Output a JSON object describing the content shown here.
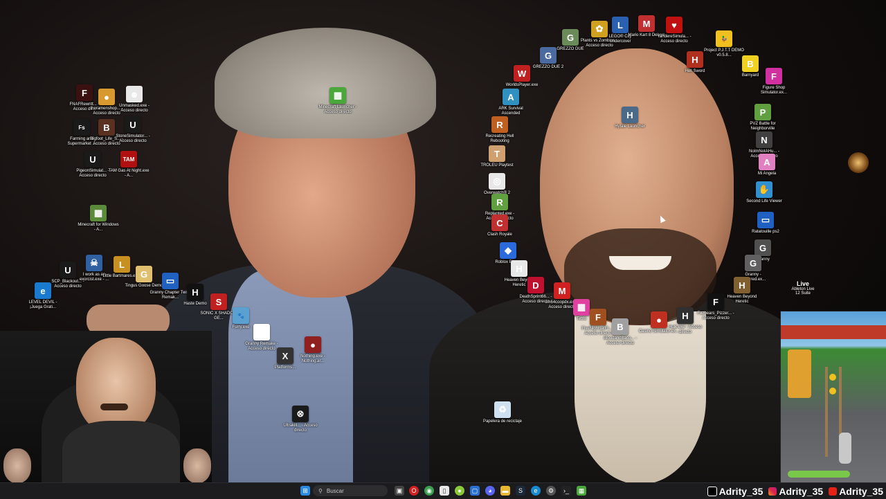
{
  "taskbar": {
    "search_placeholder": "Buscar",
    "socials": [
      {
        "icon": "tiktok-icon",
        "handle": "Adrity_35"
      },
      {
        "icon": "instagram-icon",
        "handle": "Adrity_35"
      },
      {
        "icon": "youtube-icon",
        "handle": "Adrity_35"
      }
    ],
    "apps": [
      "windows-start-icon",
      "task-view-icon",
      "opera-icon",
      "chrome-icon",
      "file-icon",
      "app-green-icon",
      "app-blue-icon",
      "discord-icon",
      "folder-icon",
      "steam-icon",
      "edge-icon",
      "settings-icon",
      "terminal-icon",
      "minecraft-icon"
    ]
  },
  "overlay": {
    "live_label": "Live",
    "ableton_label": "Ableton Live 12 Suite"
  },
  "desktop_icons": [
    {
      "name": "fnaf-rewritten-icon",
      "label": "FNAFRewritt... - Acceso dir...",
      "color": "#3a1010",
      "glyph": "F"
    },
    {
      "name": "theramenshop-icon",
      "label": "theramenshop... - Acceso directo",
      "color": "#d89a30",
      "glyph": "●"
    },
    {
      "name": "unmasked-icon",
      "label": "Unmasked.exe - Acceso directo",
      "color": "#e8e8e8",
      "glyph": "☻"
    },
    {
      "name": "farming-supermarket-icon",
      "label": "Farming and Supermarket ...",
      "color": "#1a1a1a",
      "glyph": "Fs"
    },
    {
      "name": "bigfoot-icon",
      "label": "Bigfoot_Life_S... - Acceso directo",
      "color": "#5a3020",
      "glyph": "B"
    },
    {
      "name": "stone-simulator-icon",
      "label": "StoneSimulator... - Acceso directo",
      "color": "#1a1a1a",
      "glyph": "U"
    },
    {
      "name": "pigeon-simulator-icon",
      "label": "PigeonSimulat... - Acceso directo",
      "color": "#1a1a1a",
      "glyph": "U"
    },
    {
      "name": "tam-gas-icon",
      "label": "TAM Gas At Night.exe - A...",
      "color": "#b01010",
      "glyph": "TAM"
    },
    {
      "name": "minecraft-windows-icon",
      "label": "Minecraft for Windows - A...",
      "color": "#5b8a3a",
      "glyph": "▦"
    },
    {
      "name": "minecraft-launcher-icon",
      "label": "Minecraft Launcher - Acceso directo",
      "color": "#4aa83a",
      "glyph": "▦"
    },
    {
      "name": "scp-blackout-icon",
      "label": "SCP_Blackout... - Acceso directo",
      "color": "#1a1a1a",
      "glyph": "U"
    },
    {
      "name": "exorcist-icon",
      "label": "I work as an exorcist.exe - ...",
      "color": "#3060a0",
      "glyph": "☠"
    },
    {
      "name": "little-bartmares-icon",
      "label": "Little Bartmares.ex...",
      "color": "#c89020",
      "glyph": "L"
    },
    {
      "name": "tingus-goose-icon",
      "label": "Tingus Goose Demo",
      "color": "#e0c070",
      "glyph": "G"
    },
    {
      "name": "granny-chapter-two-icon",
      "label": "Granny Chapter Two - Remak...",
      "color": "#2060c0",
      "glyph": "▭"
    },
    {
      "name": "level-devil-icon",
      "label": "LEVEL DEVIL - ¡Juega Grati...",
      "color": "#1a7ad0",
      "glyph": "e"
    },
    {
      "name": "haste-demo-icon",
      "label": "Haste Demo",
      "color": "#111111",
      "glyph": "H"
    },
    {
      "name": "sonic-shadow-icon",
      "label": "SONIC X SHADOW GE...",
      "color": "#c02020",
      "glyph": "S"
    },
    {
      "name": "furry-icon",
      "label": "Furry.exe",
      "color": "#5aa0d0",
      "glyph": "🐾"
    },
    {
      "name": "granny-remake-icon",
      "label": "Granny Remake - Acceso directo",
      "color": "#ffffff",
      "glyph": "▭"
    },
    {
      "name": "nothing-icon",
      "label": "Nothing.exe - Nothing.ar...",
      "color": "#902020",
      "glyph": "●"
    },
    {
      "name": "platforms-icon",
      "label": "Platforms...",
      "color": "#333333",
      "glyph": "X"
    },
    {
      "name": "ultrakill-icon",
      "label": "Ultrakill... - Acceso directo",
      "color": "#1a1a1a",
      "glyph": "⊗"
    },
    {
      "name": "recycle-bin-icon",
      "label": "Papelera de reciclaje",
      "color": "#cfe0f0",
      "glyph": "♻"
    },
    {
      "name": "grezzo-due-icon",
      "label": "GREZZO DUE",
      "color": "#6a8a5a",
      "glyph": "G"
    },
    {
      "name": "grezzo-due-2-icon",
      "label": "GREZZO DUE 2",
      "color": "#4a6aa0",
      "glyph": "G"
    },
    {
      "name": "plants-zombies-icon",
      "label": "Plants vs Zombies... Acceso directo",
      "color": "#d0a020",
      "glyph": "✿"
    },
    {
      "name": "lego-city-icon",
      "label": "LEGO® City Undercover",
      "color": "#2a60b0",
      "glyph": "L"
    },
    {
      "name": "mario-kart-icon",
      "label": "Mario Kart 8 Deluxe",
      "color": "#c03030",
      "glyph": "M"
    },
    {
      "name": "yandere-simulator-icon",
      "label": "YandereSimula... - Acceso directo",
      "color": "#c01010",
      "glyph": "♥"
    },
    {
      "name": "pjtt-demo-icon",
      "label": "Project P.J.T.T DEMO v0.5.8...",
      "color": "#f0c020",
      "glyph": "🦆"
    },
    {
      "name": "worldsplayer-icon",
      "label": "WorldsPlayer.exe",
      "color": "#c02020",
      "glyph": "W"
    },
    {
      "name": "hell-sword-icon",
      "label": "Hell Sword",
      "color": "#b03020",
      "glyph": "H"
    },
    {
      "name": "barnyard-icon",
      "label": "Barnyard",
      "color": "#f0d020",
      "glyph": "B"
    },
    {
      "name": "ark-survival-icon",
      "label": "ARK Survival Ascended",
      "color": "#3090c0",
      "glyph": "A"
    },
    {
      "name": "figure-shop-icon",
      "label": "Figure Shop Simulator.ex...",
      "color": "#d030a0",
      "glyph": "F"
    },
    {
      "name": "hytale-launcher-icon",
      "label": "Hytale Launcher",
      "color": "#4a6a8a",
      "glyph": "H"
    },
    {
      "name": "recreating-hell-icon",
      "label": "Recreating Hell Rebooting",
      "color": "#c06020",
      "glyph": "R"
    },
    {
      "name": "pvz-neighborville-icon",
      "label": "PVZ Battle for Neighborville",
      "color": "#60a040",
      "glyph": "P"
    },
    {
      "name": "troleu-playtest-icon",
      "label": "TROLEU Playtest",
      "color": "#d0a070",
      "glyph": "T"
    },
    {
      "name": "noimnot-icon",
      "label": "NoImNotAHu... - Acceso directo",
      "color": "#404040",
      "glyph": "N"
    },
    {
      "name": "overwatch-icon",
      "label": "Overwatch® 2",
      "color": "#e8e8e8",
      "glyph": "◎"
    },
    {
      "name": "mi-angela-icon",
      "label": "Mi Angela",
      "color": "#e080c0",
      "glyph": "A"
    },
    {
      "name": "replanted-icon",
      "label": "Replanted.exe - Acceso directo",
      "color": "#60a040",
      "glyph": "R"
    },
    {
      "name": "second-life-icon",
      "label": "Second Life Viewer",
      "color": "#3090d0",
      "glyph": "✋"
    },
    {
      "name": "clash-royale-icon",
      "label": "Clash Royale",
      "color": "#c03030",
      "glyph": "C"
    },
    {
      "name": "ratatouille-icon",
      "label": "Ratatouille ps2",
      "color": "#2060c0",
      "glyph": "▭"
    },
    {
      "name": "roblox-player-icon",
      "label": "Roblox Player",
      "color": "#2a6adc",
      "glyph": "◆"
    },
    {
      "name": "granny-icon",
      "label": "Granny",
      "color": "#505050",
      "glyph": "G"
    },
    {
      "name": "heaven-beyond-icon",
      "label": "Heaven Beyond Heretic",
      "color": "#e8e8e8",
      "glyph": "H"
    },
    {
      "name": "granny-captured-icon",
      "label": "Granny - captured.ex...",
      "color": "#606060",
      "glyph": "G"
    },
    {
      "name": "deathsprint-icon",
      "label": "DeathSprint66... - Acceso directo",
      "color": "#c01030",
      "glyph": "D"
    },
    {
      "name": "sm64-icon",
      "label": "sm64coopdx.exe - Acceso directo",
      "color": "#d02020",
      "glyph": "M"
    },
    {
      "name": "heaven-beyond-2-icon",
      "label": "Heaven Beyond Heretic",
      "color": "#806030",
      "glyph": "H"
    },
    {
      "name": "tetris-icon",
      "label": "Tetris",
      "color": "#e040a0",
      "glyph": "▦"
    },
    {
      "name": "five-nights-icon",
      "label": "FiveNightsatFr... - Acceso directo",
      "color": "#a05020",
      "glyph": "F"
    },
    {
      "name": "blood-bacon-icon",
      "label": "BloodandBaco... - Acceso directo",
      "color": "#a0a0a0",
      "glyph": "B"
    },
    {
      "name": "casino-simulator-icon",
      "label": "Casino Simulator.ex...",
      "color": "#c03020",
      "glyph": "●"
    },
    {
      "name": "hulk-icon",
      "label": "Hulk.exe - Acceso directo",
      "color": "#303030",
      "glyph": "H"
    },
    {
      "name": "fazbears-pizzeria-icon",
      "label": "Fazbears_Pizzer... - Acceso directo",
      "color": "#111111",
      "glyph": "F"
    }
  ]
}
